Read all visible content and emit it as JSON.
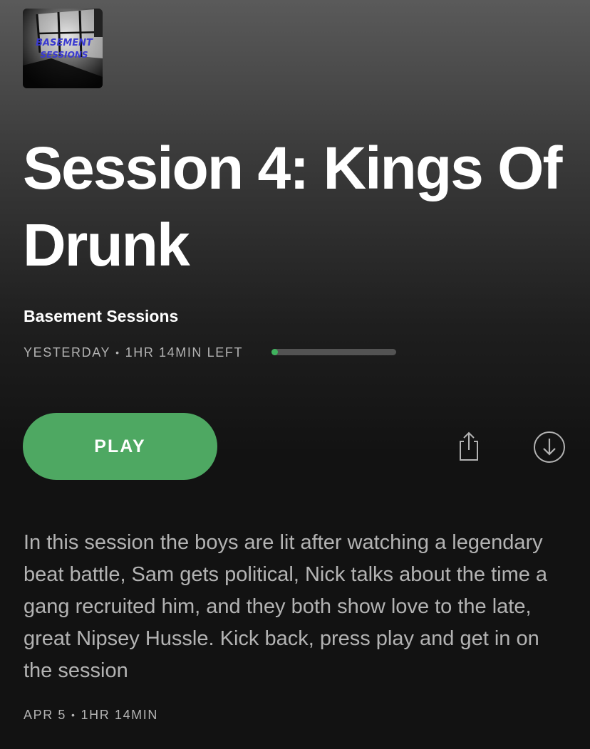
{
  "cover": {
    "logo_text_line1": "BASEMENT",
    "logo_text_line2": "SESSIONS",
    "icon": "podcast-cover-art"
  },
  "episode": {
    "title": "Session 4: Kings Of Drunk",
    "show_name": "Basement Sessions",
    "released": "YESTERDAY",
    "separator": "•",
    "time_left": "1HR 14MIN LEFT",
    "progress_fraction": 0.04
  },
  "actions": {
    "play_label": "PLAY",
    "share_icon": "share-icon",
    "download_icon": "download-icon"
  },
  "description": "In this session the boys are lit after watching a legendary beat battle, Sam gets political, Nick talks about the time a gang recruited him, and they both show love to the late, great Nipsey Hussle. Kick back, press play and get in on the session",
  "footer": {
    "date": "APR 5",
    "separator": "•",
    "duration": "1HR 14MIN"
  },
  "colors": {
    "accent": "#4ea862",
    "progress_fill": "#3fb25d",
    "progress_track": "#535353",
    "muted_text": "#b3b3b3",
    "background": "#121212"
  }
}
